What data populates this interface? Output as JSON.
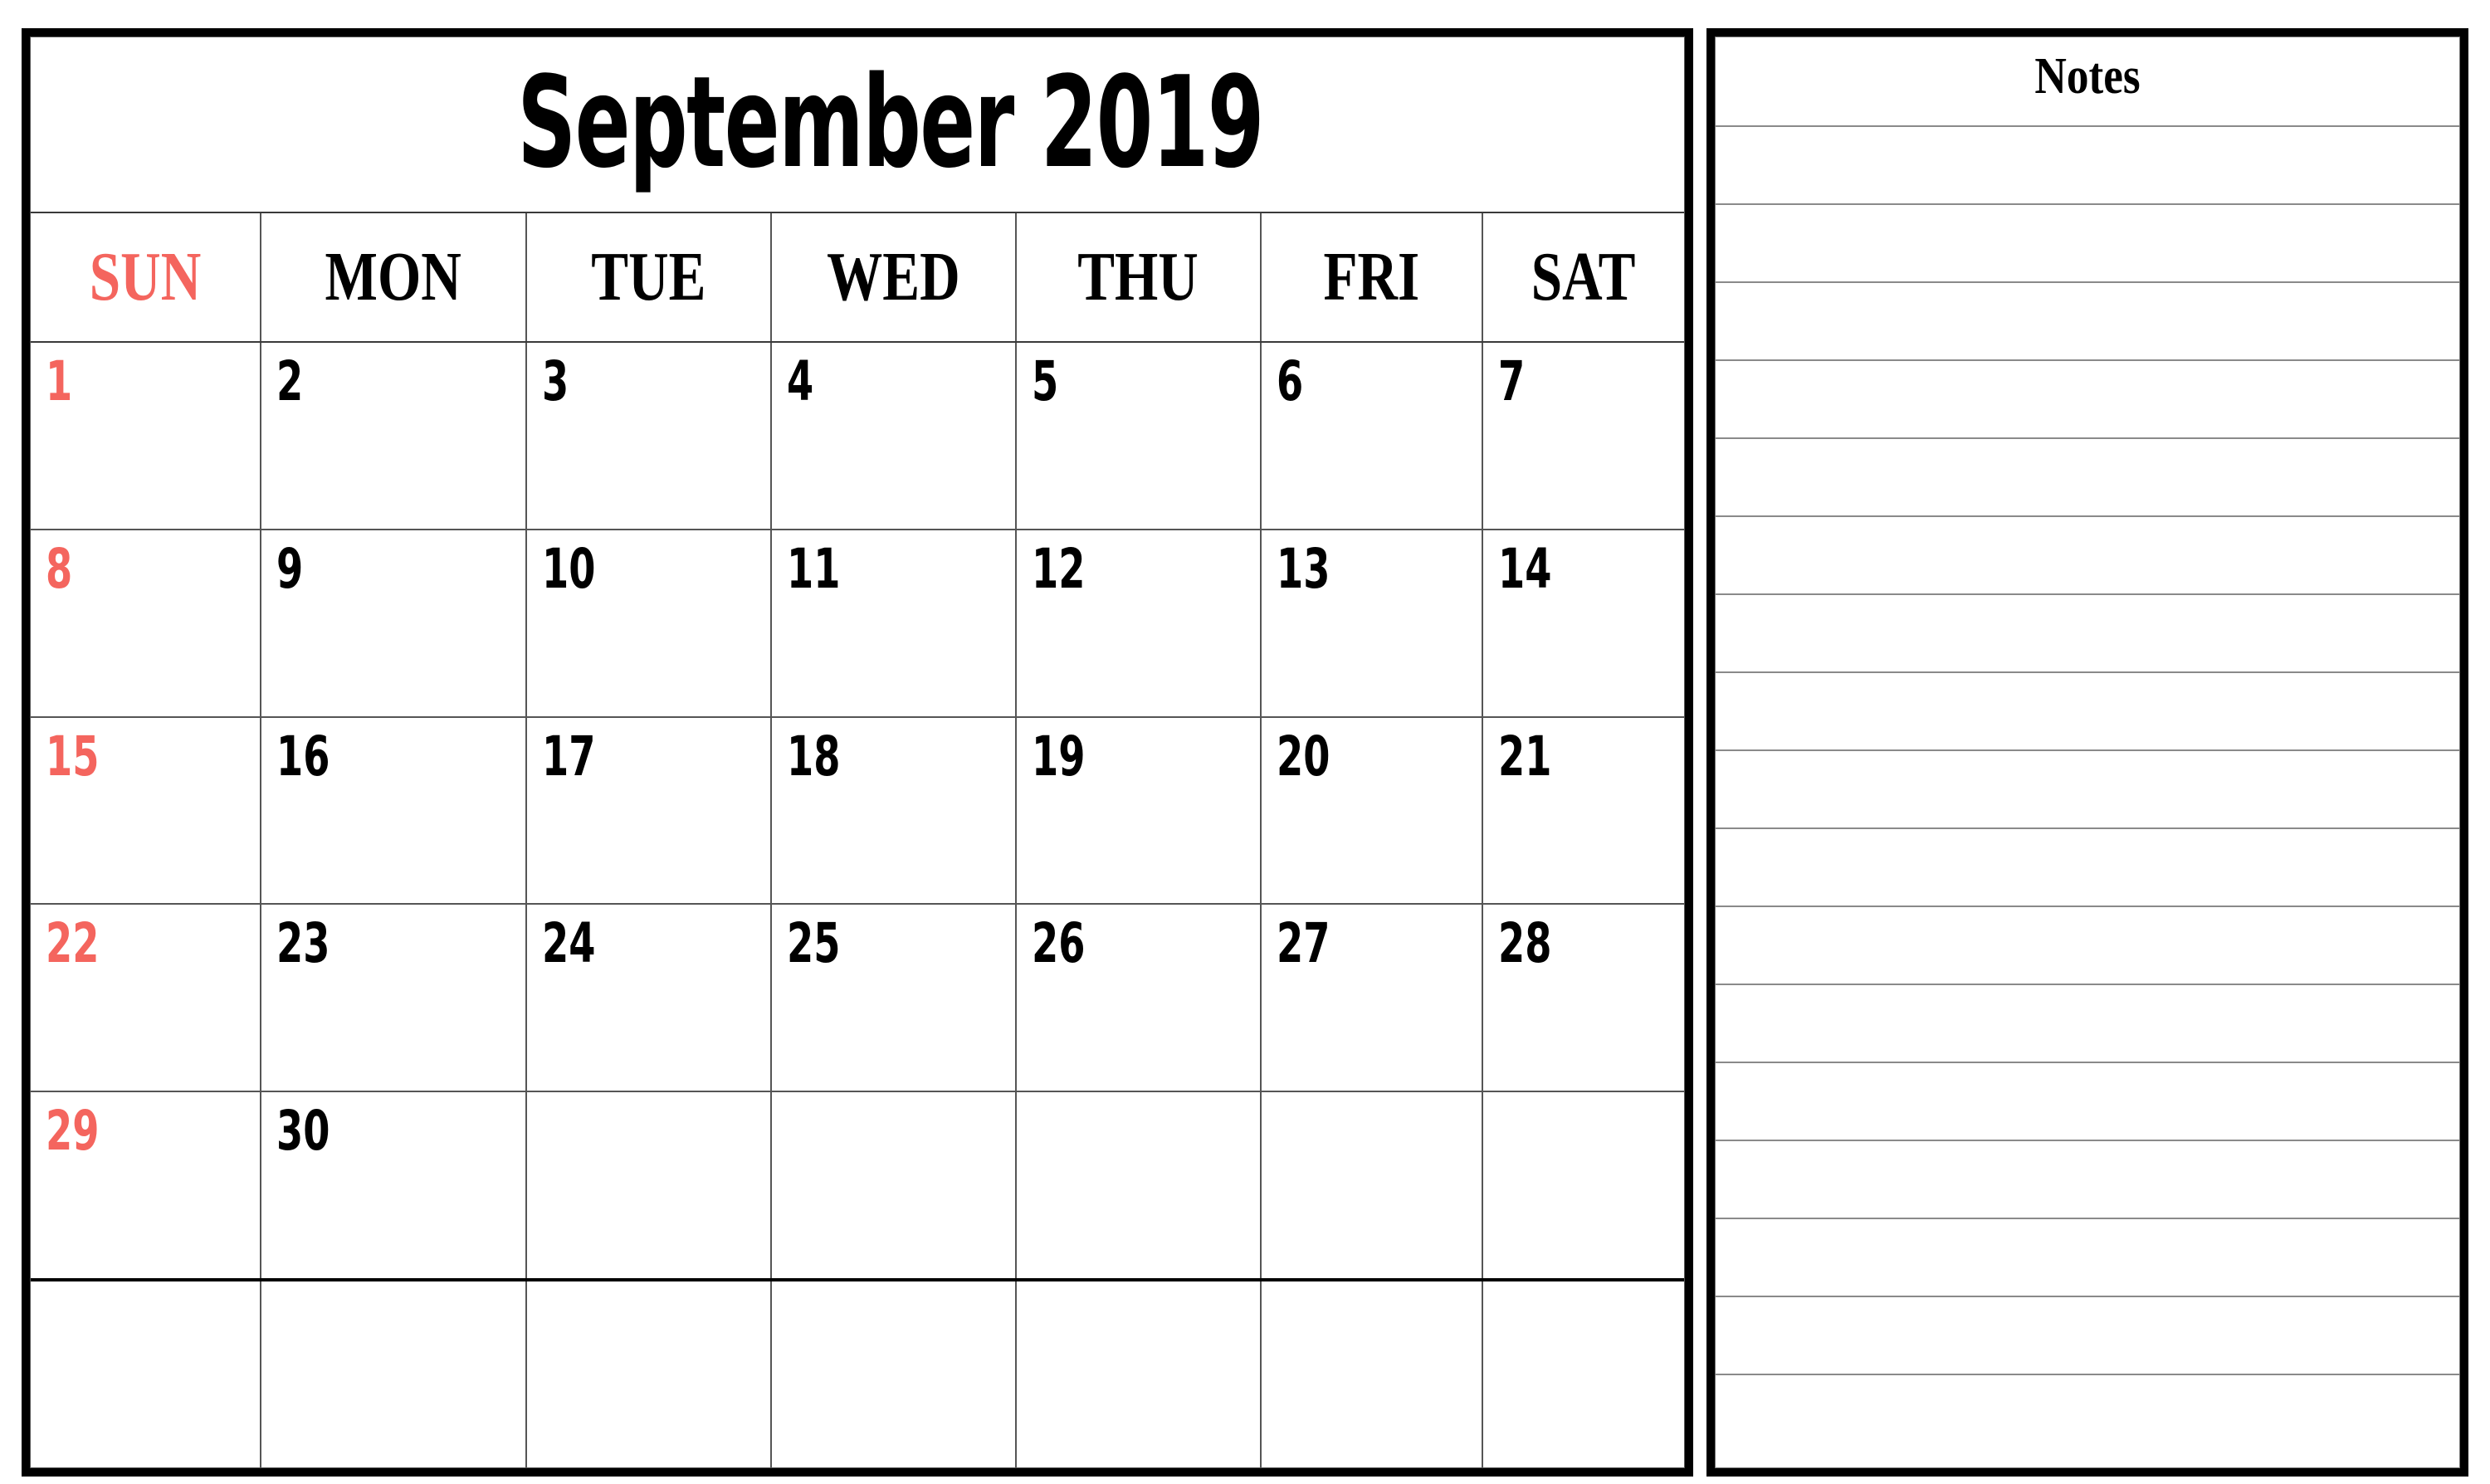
{
  "calendar": {
    "title": "September 2019",
    "weekdays": [
      {
        "label": "SUN",
        "highlight": true,
        "color": "#F4655E"
      },
      {
        "label": "MON",
        "highlight": false,
        "color": "#000000"
      },
      {
        "label": "TUE",
        "highlight": false,
        "color": "#000000"
      },
      {
        "label": "WED",
        "highlight": false,
        "color": "#000000"
      },
      {
        "label": "THU",
        "highlight": false,
        "color": "#000000"
      },
      {
        "label": "FRI",
        "highlight": false,
        "color": "#000000"
      },
      {
        "label": "SAT",
        "highlight": false,
        "color": "#000000"
      }
    ],
    "weeks": [
      {
        "days": [
          "1",
          "2",
          "3",
          "4",
          "5",
          "6",
          "7"
        ]
      },
      {
        "days": [
          "8",
          "9",
          "10",
          "11",
          "12",
          "13",
          "14"
        ]
      },
      {
        "days": [
          "15",
          "16",
          "17",
          "18",
          "19",
          "20",
          "21"
        ]
      },
      {
        "days": [
          "22",
          "23",
          "24",
          "25",
          "26",
          "27",
          "28"
        ]
      },
      {
        "days": [
          "29",
          "30",
          "",
          "",
          "",
          "",
          ""
        ]
      },
      {
        "days": [
          "",
          "",
          "",
          "",
          "",
          "",
          ""
        ]
      }
    ]
  },
  "notes": {
    "title": "Notes",
    "line_count": 17
  },
  "colors": {
    "sunday_accent": "#F4655E",
    "text": "#000000",
    "frame": "#000000",
    "grid": "#555555",
    "rule": "#8a8a8a",
    "background": "#ffffff"
  }
}
